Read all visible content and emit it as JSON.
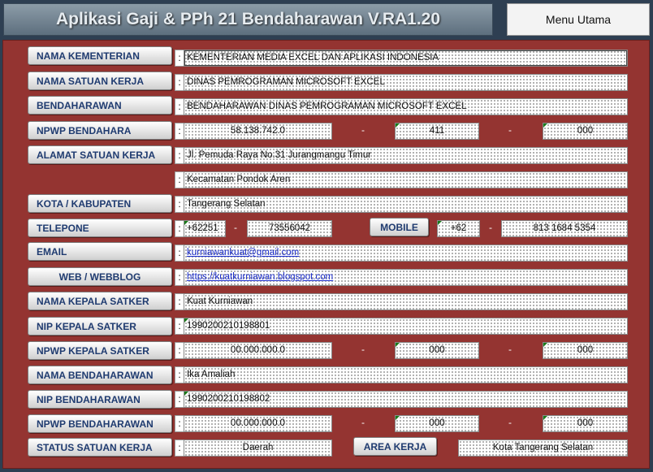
{
  "header": {
    "title": "Aplikasi Gaji & PPh 21 Bendaharawan  V.RA1.20",
    "menu_label": "Menu Utama"
  },
  "labels": {
    "kementerian": "NAMA KEMENTERIAN",
    "satuan_kerja": "NAMA SATUAN KERJA",
    "bendaharawan": "BENDAHARAWAN",
    "npwp_bendahara": "NPWP BENDAHARA",
    "alamat": "ALAMAT SATUAN  KERJA",
    "kota": "KOTA / KABUPATEN",
    "telepone": "TELEPONE",
    "mobile": "MOBILE",
    "email": "EMAIL",
    "web": "WEB / WEBBLOG",
    "kepala": "NAMA KEPALA SATKER",
    "nip_kepala": "NIP KEPALA SATKER",
    "npwp_kepala": "NPWP KEPALA SATKER",
    "nama_bend": "NAMA BENDAHARAWAN",
    "nip_bend": "NIP BENDAHARAWAN",
    "npwp_bend": "NPWP BENDAHARAWAN",
    "status": "STATUS  SATUAN  KERJA",
    "area": "AREA KERJA"
  },
  "colon": ":",
  "dash": "-",
  "values": {
    "kementerian": "KEMENTERIAN MEDIA EXCEL DAN APLIKASI INDONESIA",
    "satuan_kerja": "DINAS PEMROGRAMAN MICROSOFT EXCEL",
    "bendaharawan": "BENDAHARAWAN DINAS PEMROGRAMAN MICROSOFT EXCEL",
    "npwp_bendahara": [
      "58.138.742.0",
      "411",
      "000"
    ],
    "alamat_1": "Jl. Pemuda Raya No.31 Jurangmangu Timur",
    "alamat_2": "Kecamatan Pondok Aren",
    "kota": "Tangerang Selatan",
    "telepone": [
      "+62251",
      "73556042"
    ],
    "mobile": [
      "+62",
      "813 1684 5354"
    ],
    "email": "kurniawankuat@gmail.com",
    "web": "https://kuatkurniawan.blogspot.com",
    "kepala": "Kuat Kurniawan",
    "nip_kepala": "199020021019880​1",
    "npwp_kepala": [
      "00.000.000.0",
      "000",
      "000"
    ],
    "nama_bend": "Ika Amaliah",
    "nip_bend": "199020021019880​2",
    "npwp_bend": [
      "00.000.000.0",
      "000",
      "000"
    ],
    "status": "Daerah",
    "area": "Kota Tangerang Selatan"
  }
}
